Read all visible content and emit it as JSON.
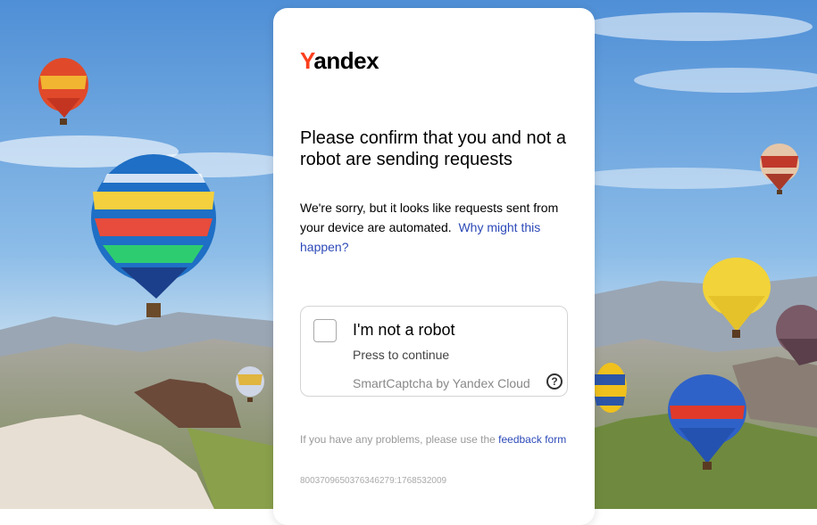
{
  "logo": {
    "first": "Y",
    "rest": "andex",
    "accent_color": "#fc3f1d"
  },
  "title": "Please confirm that you and not a robot are sending requests",
  "description": {
    "text": "We're sorry, but it looks like requests sent from your device are automated.",
    "link": "Why might this happen?"
  },
  "captcha": {
    "title": "I'm not a robot",
    "subtitle": "Press to continue",
    "brand": "SmartCaptcha by Yandex Cloud",
    "help_glyph": "?"
  },
  "problems": {
    "text": "If you have any problems, please use the",
    "link": "feedback form"
  },
  "request_id": "8003709650376346279:1768532009",
  "colors": {
    "link": "#2d4ab8",
    "sky": "#6fa4d8"
  }
}
